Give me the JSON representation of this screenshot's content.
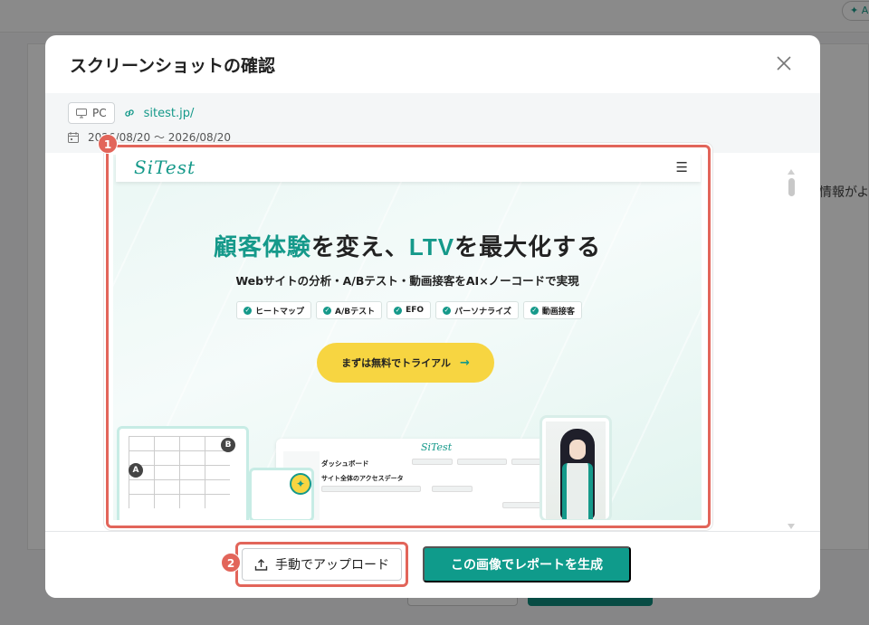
{
  "background": {
    "title_partial": "",
    "right_text": "情報がよ",
    "ai_label": "✦ A"
  },
  "modal": {
    "title": "スクリーンショットの確認",
    "device": "PC",
    "site_url": "sitest.jp/",
    "date_range": "2026/08/20 〜 2026/08/20",
    "annotations": [
      "1",
      "2"
    ],
    "footer": {
      "upload_label": "手動でアップロード",
      "generate_label": "この画像でレポートを生成"
    }
  },
  "screenshot": {
    "logo": "SiTest",
    "menu_glyph": "☰",
    "headline_accent1": "顧客体験",
    "headline_mid": "を変え、",
    "headline_accent2": "LTV",
    "headline_end": "を最大化する",
    "subheadline": "Webサイトの分析・A/Bテスト・動画接客をAI×ノーコードで実現",
    "tags": [
      "ヒートマップ",
      "A/Bテスト",
      "EFO",
      "パーソナライズ",
      "動画接客"
    ],
    "cta": "まずは無料でトライアル",
    "cta_arrow": "→",
    "dashboard_title": "ダッシュボード",
    "dashboard_sub": "サイト全体のアクセスデータ",
    "badge_a": "A",
    "badge_b": "B"
  },
  "colors": {
    "accent": "#15998a",
    "annotation": "#e2655a",
    "cta": "#f7d541",
    "primary_button": "#0f9b8b"
  }
}
